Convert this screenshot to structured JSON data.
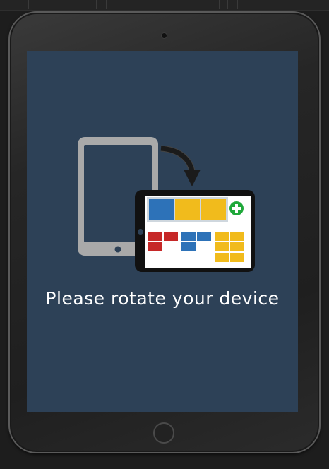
{
  "screen": {
    "message": "Please rotate your device",
    "background_color": "#2d4157"
  },
  "illustration": {
    "portrait_device_icon": "tablet-portrait-icon",
    "rotate_arrow_icon": "curved-arrow-icon",
    "landscape_device_icon": "tablet-landscape-icon",
    "add_icon": "plus-circle-icon",
    "colors": {
      "portrait_device": "#a9a9a9",
      "blue": "#2d72b8",
      "yellow": "#f1bb1c",
      "red": "#c62828",
      "green": "#1fa83a"
    }
  },
  "device_frame": {
    "camera_icon": "camera-dot-icon",
    "home_button_icon": "home-button-icon"
  }
}
